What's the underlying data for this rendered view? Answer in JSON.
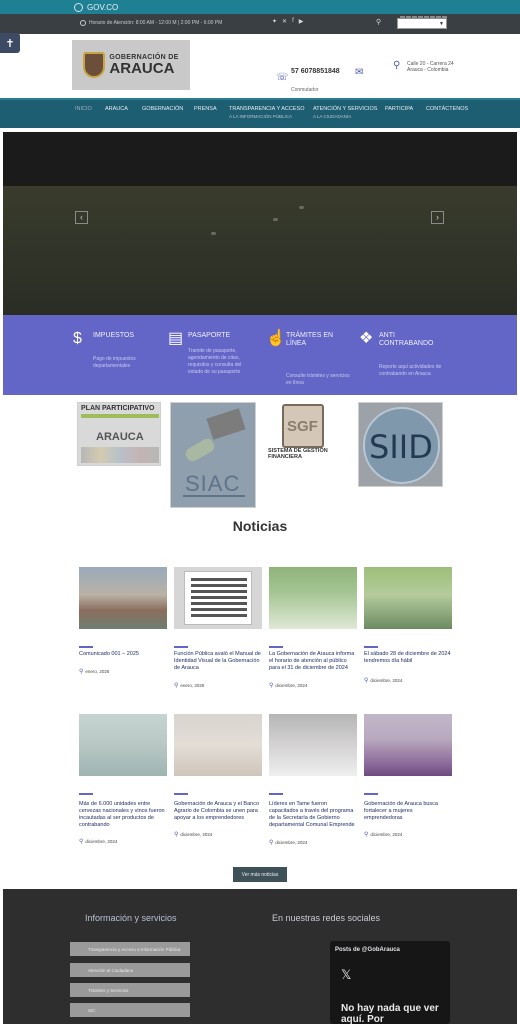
{
  "gov_bar": {
    "label": "GOV.CO"
  },
  "top_bar": {
    "hours": "Horario de Atención: 8:00 AM - 12:00 M | 2:00 PM - 6:00 PM",
    "social_icons": [
      "twitter-icon",
      "x-icon",
      "facebook-icon",
      "youtube-icon"
    ],
    "search_icon": "search-icon",
    "language_select": ""
  },
  "accessibility": {
    "icon": "accessibility-icon"
  },
  "header": {
    "logo_line1": "GOBERNACIÓN DE",
    "logo_line2": "ARAUCA",
    "phone": "57 6078851848",
    "phone_sub": "Conmutador",
    "address_line1": "Calle 20 - Carrera 24",
    "address_line2": "Arauca - Colombia"
  },
  "nav": {
    "items": [
      {
        "label": "Inicio",
        "sub": ""
      },
      {
        "label": "Arauca",
        "sub": ""
      },
      {
        "label": "Gobernación",
        "sub": ""
      },
      {
        "label": "Prensa",
        "sub": ""
      },
      {
        "label": "Transparencia y Acceso",
        "sub": "a la información pública"
      },
      {
        "label": "Atención y Servicios",
        "sub": "a la ciudadanía"
      },
      {
        "label": "Participa",
        "sub": ""
      },
      {
        "label": "Contáctenos",
        "sub": ""
      }
    ]
  },
  "slider": {
    "prev": "‹",
    "next": "›"
  },
  "services": [
    {
      "icon": "dollar-icon",
      "title": "IMPUESTOS",
      "desc": "Pago de impuestos departamentales"
    },
    {
      "icon": "passport-icon",
      "title": "PASAPORTE",
      "desc": "Tramite de pasaporte, agendamiento de citas, requisitos y consulta del estado de su pasaporte"
    },
    {
      "icon": "hand-click-icon",
      "title": "TRÁMITES EN LÍNEA",
      "desc": "Consulte trámites y servicios en línea"
    },
    {
      "icon": "bottle-icon",
      "title": "ANTI CONTRABANDO",
      "desc": "Reporte aquí actividades de contrabando en Arauca"
    }
  ],
  "banners": {
    "plan": {
      "title": "PLAN PARTICIPATIVO",
      "brand": "ARAUCA"
    },
    "siac": {
      "text": "SIAC"
    },
    "sgf": {
      "mark": "SGF",
      "caption": "SISTEMA DE GESTIÓN FINANCIERA"
    },
    "siid": {
      "text": "SIID"
    }
  },
  "news": {
    "title": "Noticias",
    "items": [
      {
        "title": "Comunicado 001 – 2025",
        "date": "enero, 2025"
      },
      {
        "title": "Función Pública avaló el Manual de Identidad Visual de la Gobernación de Arauca",
        "date": "enero, 2025"
      },
      {
        "title": "La Gobernación de Arauca informa el horario de atención al público para el 31 de diciembre de 2024",
        "date": "diciembre, 2024"
      },
      {
        "title": "El sábado 28 de diciembre de 2024 tendremos día hábil",
        "date": "diciembre, 2024"
      },
      {
        "title": "Más de 6.000 unidades entre cervezas nacionales y vinos fueron incautadas al ser productos de contrabando",
        "date": "diciembre, 2024"
      },
      {
        "title": "Gobernación de Arauca y el Banco Agrario de Colombia se unen para apoyar a los emprendedores",
        "date": "diciembre, 2024"
      },
      {
        "title": "Líderes en Tame fueron capacitados a través del programa de la Secretaría de Gobierno departamental Comunal Emprende",
        "date": "diciembre, 2024"
      },
      {
        "title": "Gobernación de Arauca busca fortalecer a mujeres emprendedoras",
        "date": "diciembre, 2024"
      }
    ],
    "more_label": "Ver más noticias"
  },
  "footer": {
    "info_title": "Información y servicios",
    "social_title": "En nuestras redes sociales",
    "links": [
      "Transparencia y Acceso a Información Pública",
      "Atención al Ciudadano",
      "Trámites y Servicios",
      "SIC"
    ],
    "twitter_head": "Posts de @GobArauca",
    "twitter_msg": "No hay nada que ver aquí. Por"
  }
}
